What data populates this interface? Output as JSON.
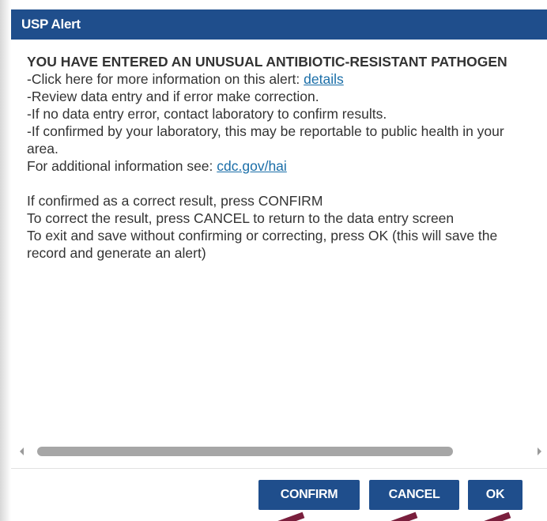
{
  "dialog": {
    "title": "USP Alert",
    "headline": "YOU HAVE ENTERED AN UNUSUAL ANTIBIOTIC-RESISTANT PATHOGEN",
    "lines": {
      "details_prefix": "-Click here for more information on this alert: ",
      "details_link": "details",
      "review": "-Review data entry and if error make correction.",
      "contact_lab": "-If no data entry error, contact laboratory to confirm results.",
      "reportable": "-If confirmed by your laboratory, this may be reportable to public health in your area.",
      "additional_prefix": "For additional information see: ",
      "additional_link": "cdc.gov/hai"
    },
    "instructions": {
      "confirm": "If confirmed as a correct result, press CONFIRM",
      "cancel": "To correct the result, press CANCEL to return to the data entry screen",
      "ok": "To exit and save without confirming or correcting, press OK (this will save the record and generate an alert)"
    },
    "buttons": {
      "confirm": "CONFIRM",
      "cancel": "CANCEL",
      "ok": "OK"
    }
  },
  "colors": {
    "primary": "#1f4e8c",
    "link": "#1a6ea8",
    "annotation_arrow": "#7a1f3d"
  }
}
